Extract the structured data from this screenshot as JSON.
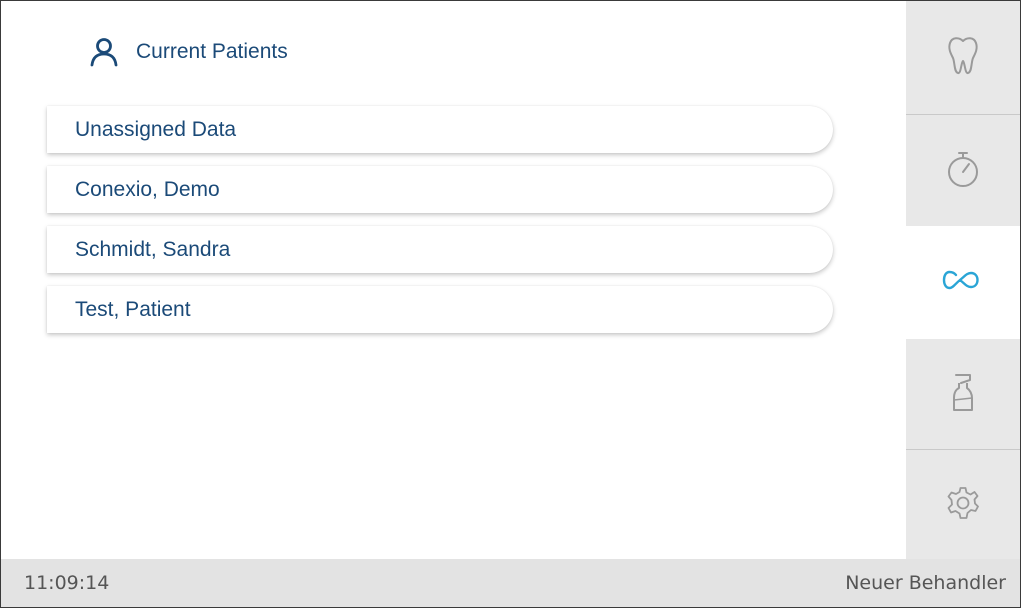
{
  "header": {
    "title": "Current Patients",
    "icon": "person-icon"
  },
  "patients": [
    {
      "label": "Unassigned Data"
    },
    {
      "label": "Conexio, Demo"
    },
    {
      "label": "Schmidt, Sandra"
    },
    {
      "label": "Test, Patient"
    }
  ],
  "sidebar": {
    "tabs": [
      {
        "icon": "tooth-icon",
        "active": false
      },
      {
        "icon": "stopwatch-icon",
        "active": false
      },
      {
        "icon": "connection-icon",
        "active": true
      },
      {
        "icon": "spray-bottle-icon",
        "active": false
      },
      {
        "icon": "gear-icon",
        "active": false
      }
    ]
  },
  "status": {
    "time": "11:09:14",
    "user": "Neuer Behandler"
  },
  "colors": {
    "text_primary": "#1b4a78",
    "accent": "#2aa5d6",
    "sidebar_bg": "#e8e8e8",
    "icon_inactive": "#9a9a9a",
    "statusbar_bg": "#e3e3e3"
  }
}
